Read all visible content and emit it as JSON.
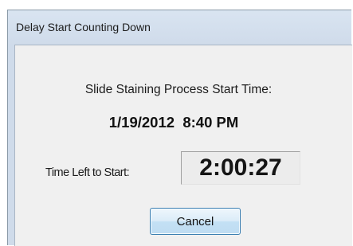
{
  "window": {
    "title": "Delay Start Counting Down"
  },
  "dialog": {
    "process_label": "Slide Staining Process Start Time:",
    "start_time": "1/19/2012  8:40 PM",
    "time_left_label": "Time Left to Start:",
    "countdown": "2:00:27",
    "cancel_label": "Cancel"
  }
}
